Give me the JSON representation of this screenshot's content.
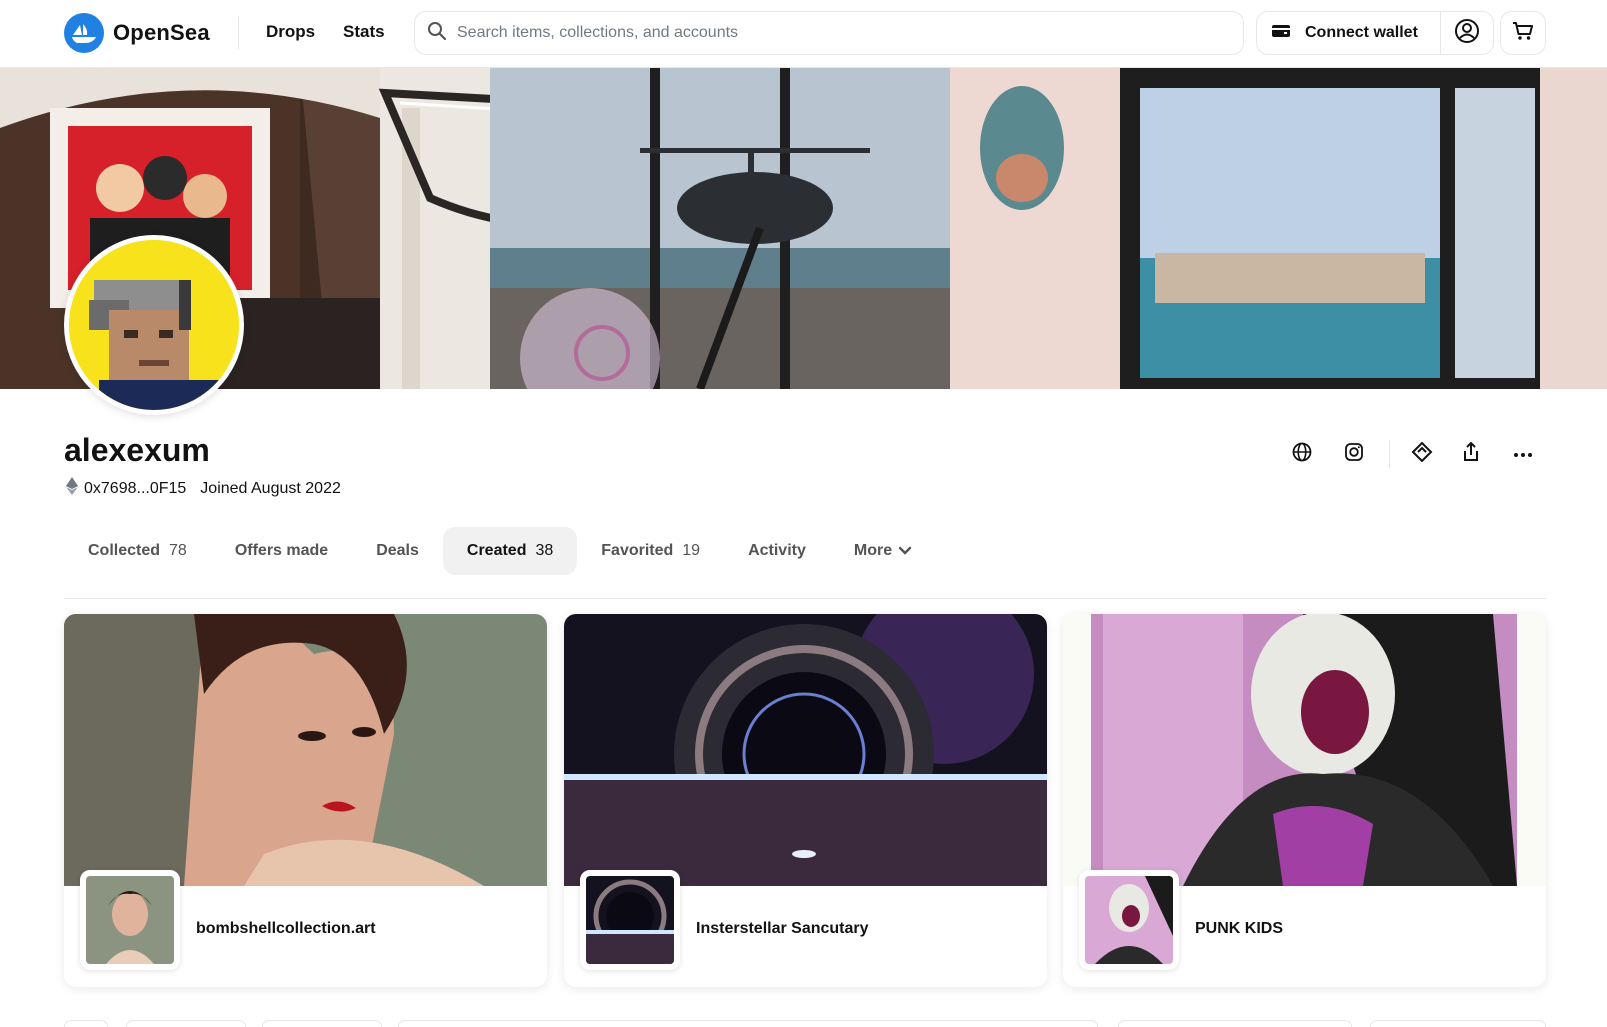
{
  "header": {
    "brand": "OpenSea",
    "nav": [
      {
        "label": "Drops"
      },
      {
        "label": "Stats"
      }
    ],
    "search_placeholder": "Search items, collections, and accounts",
    "wallet_label": "Connect wallet"
  },
  "profile": {
    "username": "alexexum",
    "address": "0x7698...0F15",
    "joined": "Joined August 2022"
  },
  "tabs": [
    {
      "label": "Collected",
      "count": "78",
      "active": false
    },
    {
      "label": "Offers made",
      "count": "",
      "active": false
    },
    {
      "label": "Deals",
      "count": "",
      "active": false
    },
    {
      "label": "Created",
      "count": "38",
      "active": true
    },
    {
      "label": "Favorited",
      "count": "19",
      "active": false
    },
    {
      "label": "Activity",
      "count": "",
      "active": false
    },
    {
      "label": "More",
      "count": "",
      "active": false
    }
  ],
  "collections": [
    {
      "name": "bombshellcollection.art"
    },
    {
      "name": "Insterstellar Sancutary"
    },
    {
      "name": "PUNK KIDS"
    }
  ],
  "colors": {
    "brand": "#2081e2",
    "text": "#121212",
    "muted": "#545454",
    "border": "#e5e8eb",
    "avatar_bg": "#f8e21c"
  },
  "icons": [
    "opensea-logo-icon",
    "search-icon",
    "wallet-icon",
    "account-icon",
    "cart-icon",
    "ethereum-icon",
    "globe-icon",
    "instagram-icon",
    "foundation-icon",
    "share-icon",
    "more-dots-icon",
    "chevron-down-icon"
  ]
}
